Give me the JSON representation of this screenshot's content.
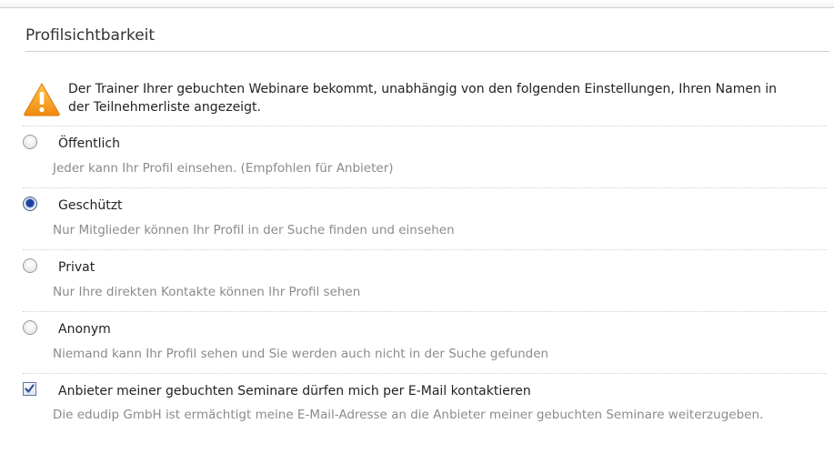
{
  "section": {
    "title": "Profilsichtbarkeit"
  },
  "warning": {
    "icon": "warning-icon",
    "text": "Der Trainer Ihrer gebuchten Webinare bekommt, unabhängig von den folgenden Einstellungen, Ihren Namen in der Teilnehmerliste angezeigt."
  },
  "visibility_options": [
    {
      "label": "Öffentlich",
      "description": "Jeder kann Ihr Profil einsehen. (Empfohlen für Anbieter)",
      "selected": false
    },
    {
      "label": "Geschützt",
      "description": "Nur Mitglieder können Ihr Profil in der Suche finden und einsehen",
      "selected": true
    },
    {
      "label": "Privat",
      "description": "Nur Ihre direkten Kontakte können Ihr Profil sehen",
      "selected": false
    },
    {
      "label": "Anonym",
      "description": "Niemand kann Ihr Profil sehen und Sie werden auch nicht in der Suche gefunden",
      "selected": false
    }
  ],
  "contact_permission": {
    "label": "Anbieter meiner gebuchten Seminare dürfen mich per E-Mail kontaktieren",
    "description": "Die edudip GmbH ist ermächtigt meine E-Mail-Adresse an die Anbieter meiner gebuchten Seminare weiterzugeben.",
    "checked": true
  },
  "colors": {
    "warning_fill": "#f7a21b",
    "radio_selected": "#1a3f9c",
    "checkbox_mark": "#2b4f9a"
  }
}
